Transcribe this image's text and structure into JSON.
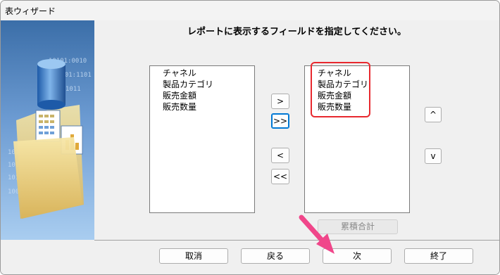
{
  "window": {
    "title": "表ウィザード"
  },
  "heading": "レポートに表示するフィールドを指定してください。",
  "available_fields": [
    "チャネル",
    "製品カテゴリ",
    "販売金額",
    "販売数量"
  ],
  "selected_fields": [
    "チャネル",
    "製品カテゴリ",
    "販売金額",
    "販売数量"
  ],
  "move_buttons": {
    "add": ">",
    "add_all": ">>",
    "remove": "<",
    "remove_all": "<<"
  },
  "order_buttons": {
    "up": "^",
    "down": "v"
  },
  "cumulative_button": "累積合計",
  "footer_buttons": {
    "cancel": "取消",
    "back": "戻る",
    "next": "次",
    "finish": "終了"
  },
  "side_panel_art": {
    "binary_rows": [
      "10101:0010",
      "0101:1101",
      "1011",
      "10101:0010",
      "10101:1101",
      "10101110011",
      "10011:0011"
    ]
  },
  "annotations": {
    "highlight_color": "#e8292f",
    "arrow_color": "#f0468a"
  }
}
